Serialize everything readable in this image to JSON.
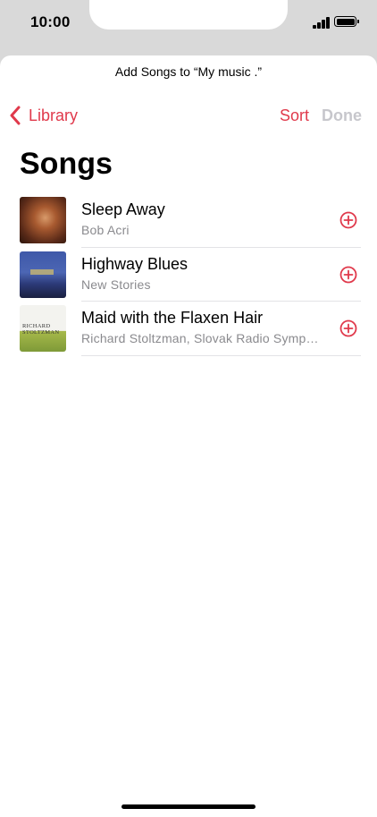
{
  "status_bar": {
    "time": "10:00"
  },
  "sheet": {
    "title": "Add Songs to “My music .”"
  },
  "nav": {
    "back_label": "Library",
    "sort_label": "Sort",
    "done_label": "Done"
  },
  "page": {
    "title": "Songs"
  },
  "songs": [
    {
      "title": "Sleep Away",
      "artist": "Bob Acri"
    },
    {
      "title": "Highway Blues",
      "artist": "New Stories"
    },
    {
      "title": "Maid with the Flaxen Hair",
      "artist": "Richard Stoltzman, Slovak Radio Symp…",
      "art_text_1": "RICHARD",
      "art_text_2": "STOLTZMAN"
    }
  ],
  "colors": {
    "accent": "#e0394b",
    "disabled": "#c7c7cc",
    "secondary_text": "#8a8a8e"
  },
  "icons": {
    "back": "chevron-left-icon",
    "add": "plus-circle-icon",
    "battery": "battery-icon",
    "signal": "cellular-signal-icon"
  }
}
